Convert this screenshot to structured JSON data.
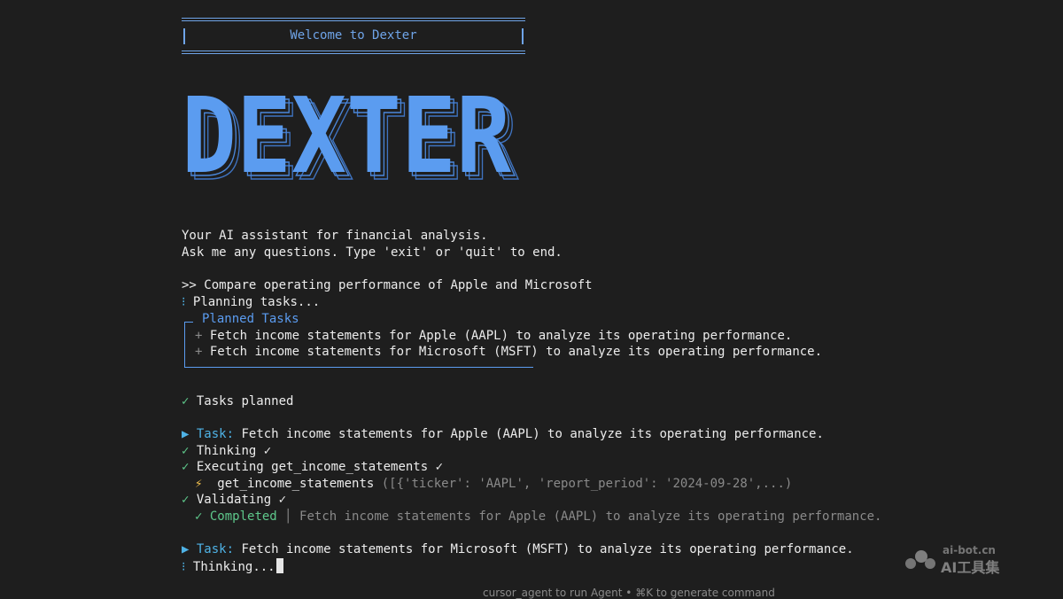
{
  "welcome": {
    "title": "Welcome to Dexter"
  },
  "logo": {
    "text": "DEXTER",
    "color": "#5b9cf0"
  },
  "intro": {
    "line1": "Your AI assistant for financial analysis.",
    "line2": "Ask me any questions. Type 'exit' or 'quit' to end."
  },
  "query": {
    "prompt": ">>",
    "text": "Compare operating performance of Apple and Microsoft"
  },
  "planning": {
    "spinner": "⁝",
    "text": "Planning tasks..."
  },
  "planned_tasks": {
    "title": "Planned Tasks",
    "items": [
      {
        "bullet": "+",
        "text": "Fetch income statements for Apple (AAPL) to analyze its operating performance."
      },
      {
        "bullet": "+",
        "text": "Fetch income statements for Microsoft (MSFT) to analyze its operating performance."
      }
    ]
  },
  "tasks_planned": {
    "check": "✓",
    "text": "Tasks planned"
  },
  "task1": {
    "arrow": "▶",
    "label": "Task:",
    "text": "Fetch income statements for Apple (AAPL) to analyze its operating performance.",
    "thinking": "Thinking ✓",
    "executing": "Executing get_income_statements ✓",
    "tool_icon": "⚡",
    "tool_name": "get_income_statements",
    "tool_args": "([{'ticker': 'AAPL', 'report_period': '2024-09-28',...)",
    "validating": "Validating ✓",
    "completed_label": "Completed",
    "completed_sep": "│",
    "completed_text": "Fetch income statements for Apple (AAPL) to analyze its operating performance.",
    "check": "✓"
  },
  "task2": {
    "arrow": "▶",
    "label": "Task:",
    "text": "Fetch income statements for Microsoft (MSFT) to analyze its operating performance.",
    "spinner": "⁝",
    "thinking": "Thinking..."
  },
  "footer": {
    "hint": "cursor_agent to run Agent • ⌘K to generate command"
  },
  "watermark": {
    "domain": "ai-bot.cn",
    "brand": "AI工具集"
  },
  "colors": {
    "background": "#1e1e1e",
    "accent": "#5b9cf0",
    "success": "#5ec88b",
    "task_label": "#4fb3e6"
  }
}
